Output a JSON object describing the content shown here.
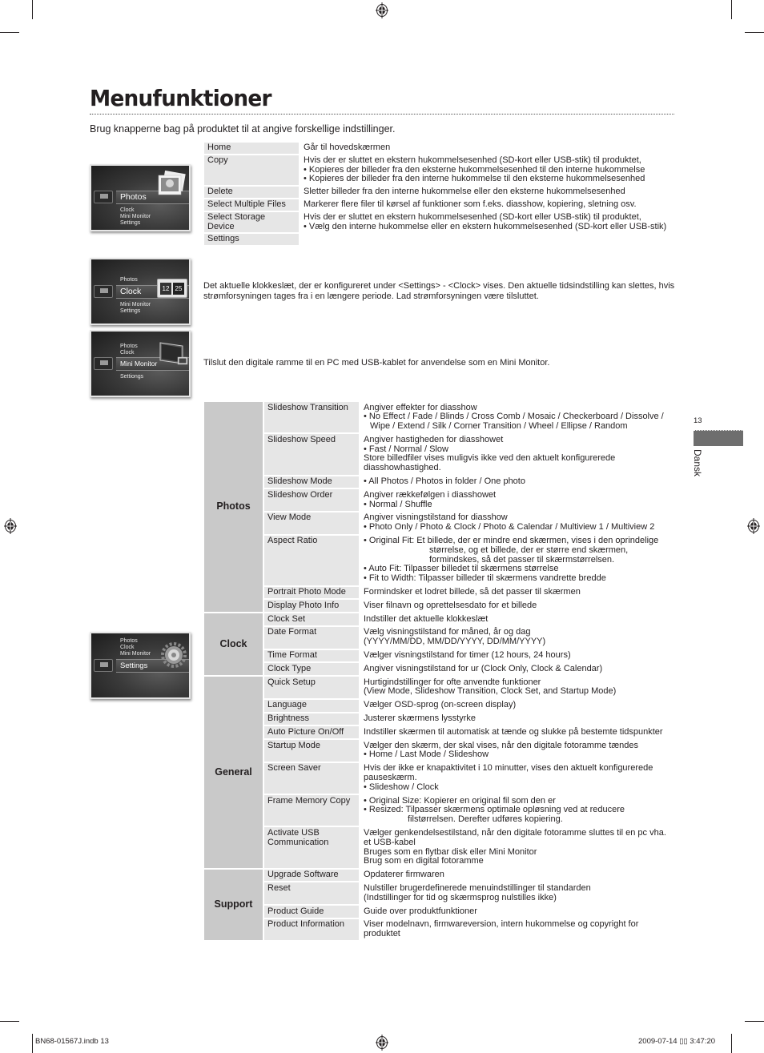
{
  "page": {
    "title": "Menufunktioner",
    "intro": "Brug knapperne bag på produktet til at angive forskellige indstillinger.",
    "page_number": "13",
    "language_tab": "Dansk",
    "footer_left": "BN68-01567J.indb   13",
    "footer_right": "2009-07-14   ▯▯ 3:47:20"
  },
  "screens": [
    {
      "name": "photos-screen",
      "items": [
        "Photos",
        "Clock",
        "Mini Monitor",
        "Settings"
      ],
      "selected": "Photos",
      "icon": "photo-stack-icon"
    },
    {
      "name": "clock-screen",
      "items": [
        "Photos",
        "Clock",
        "Mini Monitor",
        "Settings"
      ],
      "selected": "Clock",
      "icon": "flip-clock-icon",
      "clock_digits": [
        "12",
        "25"
      ]
    },
    {
      "name": "mini-monitor-screen",
      "items": [
        "Photos",
        "Clock",
        "Mini Monitor",
        "Settiongs"
      ],
      "selected": "Mini Monitor",
      "icon": "monitor-icon"
    },
    {
      "name": "settings-screen",
      "items": [
        "Photos",
        "Clock",
        "Mini Monitor",
        "Settings"
      ],
      "selected": "Settings",
      "icon": "gear-icon"
    }
  ],
  "photos_table": [
    {
      "key": "Home",
      "lines": [
        "Går til hovedskærmen"
      ]
    },
    {
      "key": "Copy",
      "lines": [
        "Hvis der er sluttet en ekstern hukommelsesenhed (SD-kort eller USB-stik) til produktet,",
        "• Kopieres der billeder fra den eksterne hukommelsesenhed til den interne hukommelse",
        "• Kopieres der billeder fra den interne hukommelse til den eksterne hukommelsesenhed"
      ]
    },
    {
      "key": "Delete",
      "lines": [
        "Sletter billeder fra den interne hukommelse eller den eksterne hukommelsesenhed"
      ]
    },
    {
      "key": "Select Multiple Files",
      "lines": [
        "Markerer flere filer til kørsel af funktioner som f.eks. diasshow, kopiering, sletning osv."
      ]
    },
    {
      "key": "Select Storage Device",
      "lines": [
        "Hvis der er sluttet en ekstern hukommelsesenhed (SD-kort eller USB-stik) til produktet,",
        "• Vælg den interne hukommelse eller en ekstern hukommelsesenhed (SD-kort eller USB-stik)"
      ]
    },
    {
      "key": "Settings",
      "lines": [
        ""
      ]
    }
  ],
  "clock_text": "Det aktuelle klokkeslæt, der er konfigureret under <Settings> - <Clock> vises. Den aktuelle tidsindstilling kan slettes, hvis strømforsyningen tages fra i en længere periode. Lad strømforsyningen være tilsluttet.",
  "mini_monitor_text": "Tilslut den digitale ramme til en PC med USB-kablet for anvendelse som en Mini Monitor.",
  "settings_table": [
    {
      "category": "Photos",
      "rows": [
        {
          "key": "Slideshow Transition",
          "lines": [
            "Angiver effekter for diasshow",
            "• No Effect / Fade / Blinds / Cross Comb / Mosaic / Checkerboard / Dissolve / Wipe / Extend / Silk / Corner Transition / Wheel / Ellipse / Random"
          ]
        },
        {
          "key": "Slideshow Speed",
          "lines": [
            "Angiver hastigheden for diasshowet",
            "• Fast / Normal / Slow",
            "Store billedfiler vises muligvis ikke ved den aktuelt konfigurerede diasshowhastighed."
          ]
        },
        {
          "key": "Slideshow Mode",
          "lines": [
            "• All Photos / Photos in folder / One photo"
          ]
        },
        {
          "key": "Slideshow Order",
          "lines": [
            "Angiver rækkefølgen i diasshowet",
            "• Normal / Shuffle"
          ]
        },
        {
          "key": "View Mode",
          "lines": [
            "Angiver visningstilstand for diasshow",
            "• Photo Only / Photo & Clock / Photo & Calendar / Multiview 1 / Multiview 2"
          ]
        },
        {
          "key": "Aspect Ratio",
          "lines": [
            "• Original Fit: Et billede, der er mindre end skærmen, vises i den oprindelige",
            "størrelse, og et billede, der er større end skærmen,",
            "formindskes, så det passer til skærmstørrelsen.",
            "• Auto Fit: Tilpasser billedet til skærmens størrelse",
            "• Fit to Width: Tilpasser billeder til skærmens vandrette bredde"
          ]
        },
        {
          "key": "Portrait Photo Mode",
          "lines": [
            "Formindsker et lodret billede, så det passer til skærmen"
          ]
        },
        {
          "key": "Display Photo Info",
          "lines": [
            "Viser filnavn og oprettelsesdato for et billede"
          ]
        }
      ]
    },
    {
      "category": "Clock",
      "rows": [
        {
          "key": "Clock Set",
          "lines": [
            "Indstiller det aktuelle klokkeslæt"
          ]
        },
        {
          "key": "Date Format",
          "lines": [
            "Vælg visningstilstand for måned, år og dag",
            "(YYYY/MM/DD, MM/DD/YYYY, DD/MM/YYYY)"
          ]
        },
        {
          "key": "Time Format",
          "lines": [
            "Vælger visningstilstand for timer (12 hours, 24 hours)"
          ]
        },
        {
          "key": "Clock Type",
          "lines": [
            "Angiver visningstilstand for ur (Clock Only, Clock & Calendar)"
          ]
        }
      ]
    },
    {
      "category": "General",
      "rows": [
        {
          "key": "Quick Setup",
          "lines": [
            "Hurtigindstillinger for ofte anvendte funktioner",
            "(View Mode, Slideshow Transition, Clock Set, and Startup Mode)"
          ]
        },
        {
          "key": "Language",
          "lines": [
            "Vælger OSD-sprog (on-screen display)"
          ]
        },
        {
          "key": "Brightness",
          "lines": [
            "Justerer skærmens lysstyrke"
          ]
        },
        {
          "key": "Auto Picture On/Off",
          "lines": [
            "Indstiller skærmen til automatisk at tænde og slukke på bestemte tidspunkter"
          ]
        },
        {
          "key": "Startup Mode",
          "lines": [
            "Vælger den skærm, der skal vises, når den digitale fotoramme tændes",
            "• Home / Last Mode / Slideshow"
          ]
        },
        {
          "key": "Screen Saver",
          "lines": [
            "Hvis der ikke er knapaktivitet i 10 minutter, vises den aktuelt konfigurerede pauseskærm.",
            "• Slideshow / Clock"
          ]
        },
        {
          "key": "Frame Memory Copy",
          "lines": [
            "• Original Size: Kopierer en original fil som den er",
            "• Resized: Tilpasser skærmens optimale opløsning ved at reducere",
            "filstørrelsen. Derefter udføres kopiering."
          ]
        },
        {
          "key": "Activate USB Communication",
          "lines": [
            "Vælger genkendelsestilstand, når den digitale fotoramme sluttes til en pc vha. et USB-kabel",
            "Bruges som en flytbar disk eller Mini Monitor",
            "Brug som en digital fotoramme"
          ]
        }
      ]
    },
    {
      "category": "Support",
      "rows": [
        {
          "key": "Upgrade Software",
          "lines": [
            "Opdaterer firmwaren"
          ]
        },
        {
          "key": "Reset",
          "lines": [
            "Nulstiller brugerdefinerede menuindstillinger til standarden",
            "(Indstillinger for tid og skærmsprog nulstilles ikke)"
          ]
        },
        {
          "key": "Product Guide",
          "lines": [
            "Guide over produktfunktioner"
          ]
        },
        {
          "key": "Product Information",
          "lines": [
            "Viser modelnavn, firmwareversion, intern hukommelse og copyright for produktet"
          ]
        }
      ]
    }
  ]
}
